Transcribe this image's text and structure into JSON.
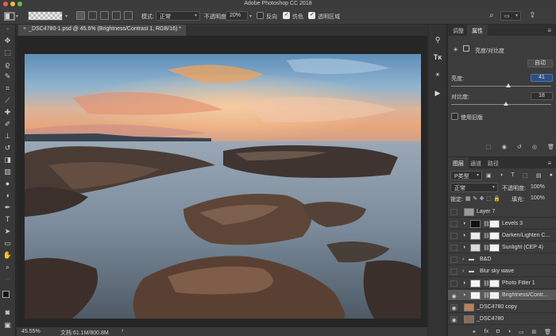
{
  "titlebar": {
    "title": "Adobe Photoshop CC 2018"
  },
  "options": {
    "mode_label": "模式:",
    "mode_value": "正常",
    "opacity_label": "不透明度:",
    "opacity_value": "20%",
    "reverse_label": "反向",
    "dither_label": "仿色",
    "transparency_label": "透明区域"
  },
  "document": {
    "tab_title": "_DSC4780-1.psd @ 45.6% (Brightness/Contrast 1, RGB/16) *",
    "zoom": "45.55%",
    "doc_size": "文档:61.1M/800.8M"
  },
  "properties": {
    "tab_adjust": "调整",
    "tab_props": "属性",
    "adjustment_name": "亮度/对比度",
    "auto_button": "自动",
    "brightness_label": "亮度:",
    "brightness_value": "41",
    "brightness_fraction": 0.57,
    "contrast_label": "对比度:",
    "contrast_value": "18",
    "contrast_fraction": 0.55,
    "legacy_label": "使用旧版"
  },
  "layers": {
    "tab_layers": "图层",
    "tab_channels": "通道",
    "tab_paths": "路径",
    "filter_kind": "P类型",
    "blend_mode": "正常",
    "opacity_label": "不透明度:",
    "opacity_value": "100%",
    "lock_label": "锁定:",
    "fill_label": "填充:",
    "fill_value": "100%",
    "items": [
      {
        "name": "Layer 7",
        "visible": false,
        "kind": "pixel",
        "thumb": "#9a9a9a"
      },
      {
        "name": "Levels 3",
        "visible": false,
        "kind": "adjust",
        "thumb": "#111"
      },
      {
        "name": "Darken/Lighten C...",
        "visible": false,
        "kind": "adjust",
        "thumb": "#ececec"
      },
      {
        "name": "Sunlight (CEP 4)",
        "visible": false,
        "kind": "adjust",
        "thumb": "#d8d8d8"
      },
      {
        "name": "B&D",
        "visible": false,
        "kind": "group",
        "thumb": ""
      },
      {
        "name": "Blur sky wave",
        "visible": false,
        "kind": "group",
        "thumb": ""
      },
      {
        "name": "Photo Filter 1",
        "visible": false,
        "kind": "adjust",
        "thumb": "#f4f4f4"
      },
      {
        "name": "Brightness/Contr...",
        "visible": true,
        "kind": "adjust",
        "thumb": "#f4f4f4",
        "selected": true
      },
      {
        "name": "_DSC4780 copy",
        "visible": true,
        "kind": "pixel",
        "thumb": "#b9805a"
      },
      {
        "name": "_DSC4780",
        "visible": true,
        "kind": "pixel",
        "thumb": "#8a6a58"
      }
    ]
  },
  "colors": {
    "bg": "#2b2b2b",
    "panel": "#3c3c3c",
    "accent_field": "#4a78b8"
  }
}
